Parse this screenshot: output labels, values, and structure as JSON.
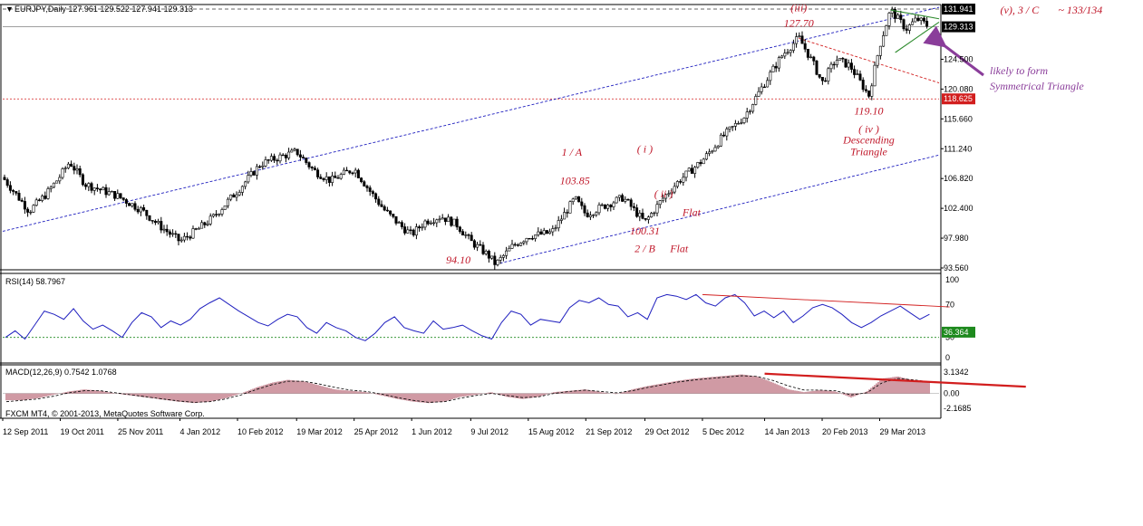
{
  "chart_data": [
    {
      "panel": "price",
      "type": "candlestick",
      "header": "EURJPY,Daily  127.961 129.522 127.941 129.313",
      "y_ticks": [
        "131.941",
        "129.313",
        "124.500",
        "120.080",
        "118.625",
        "115.660",
        "111.240",
        "106.820",
        "102.400",
        "97.980",
        "93.560"
      ],
      "ylim": [
        93.56,
        131.941
      ],
      "price_tags": [
        {
          "label": "131.941",
          "value": 131.941,
          "color": "#000000"
        },
        {
          "label": "129.313",
          "value": 129.313,
          "color": "#000000"
        },
        {
          "label": "118.625",
          "value": 118.625,
          "color": "#d21e1e"
        }
      ],
      "x_labels": [
        "12 Sep 2011",
        "19 Oct 2011",
        "25 Nov 2011",
        "4 Jan 2012",
        "10 Feb 2012",
        "19 Mar 2012",
        "25 Apr 2012",
        "1 Jun 2012",
        "9 Jul 2012",
        "15 Aug 2012",
        "21 Sep 2012",
        "29 Oct 2012",
        "5 Dec 2012",
        "14 Jan 2013",
        "20 Feb 2013",
        "29 Mar 2013"
      ],
      "price_path": [
        [
          "12 Sep 2011",
          107.0
        ],
        [
          "29 Sep 2011",
          102.0
        ],
        [
          "10 Oct 2011",
          104.5
        ],
        [
          "19 Oct 2011",
          107.2
        ],
        [
          "25 Oct 2011",
          109.3
        ],
        [
          "4 Nov 2011",
          106.0
        ],
        [
          "25 Nov 2011",
          104.2
        ],
        [
          "10 Dec 2011",
          102.2
        ],
        [
          "22 Dec 2011",
          99.8
        ],
        [
          "4 Jan 2012",
          97.5
        ],
        [
          "15 Jan 2012",
          99.2
        ],
        [
          "25 Jan 2012",
          101.0
        ],
        [
          "10 Feb 2012",
          105.0
        ],
        [
          "25 Feb 2012",
          109.0
        ],
        [
          "8 Mar 2012",
          110.0
        ],
        [
          "19 Mar 2012",
          110.8
        ],
        [
          "30 Mar 2012",
          108.0
        ],
        [
          "10 Apr 2012",
          106.5
        ],
        [
          "25 Apr 2012",
          108.3
        ],
        [
          "5 May 2012",
          105.0
        ],
        [
          "15 May 2012",
          102.0
        ],
        [
          "25 May 2012",
          99.8
        ],
        [
          "1 Jun 2012",
          98.5
        ],
        [
          "10 Jun 2012",
          100.5
        ],
        [
          "20 Jun 2012",
          101.2
        ],
        [
          "30 Jun 2012",
          100.0
        ],
        [
          "9 Jul 2012",
          97.5
        ],
        [
          "20 Jul 2012",
          95.5
        ],
        [
          "25 Jul 2012",
          94.1
        ],
        [
          "5 Aug 2012",
          96.8
        ],
        [
          "15 Aug 2012",
          98.3
        ],
        [
          "30 Aug 2012",
          98.8
        ],
        [
          "14 Sep 2012",
          103.85
        ],
        [
          "21 Sep 2012",
          101.5
        ],
        [
          "5 Oct 2012",
          103.0
        ],
        [
          "15 Oct 2012",
          104.0
        ],
        [
          "29 Oct 2012",
          100.31
        ],
        [
          "10 Nov 2012",
          104.0
        ],
        [
          "20 Nov 2012",
          106.5
        ],
        [
          "5 Dec 2012",
          109.5
        ],
        [
          "18 Dec 2012",
          113.0
        ],
        [
          "1 Jan 2013",
          116.0
        ],
        [
          "14 Jan 2013",
          121.0
        ],
        [
          "25 Jan 2013",
          125.0
        ],
        [
          "5 Feb 2013",
          127.7
        ],
        [
          "14 Feb 2013",
          124.0
        ],
        [
          "20 Feb 2013",
          121.0
        ],
        [
          "1 Mar 2013",
          124.5
        ],
        [
          "10 Mar 2013",
          123.5
        ],
        [
          "22 Mar 2013",
          119.1
        ],
        [
          "29 Mar 2013",
          126.5
        ],
        [
          "5 Apr 2013",
          131.8
        ],
        [
          "15 Apr 2013",
          129.0
        ],
        [
          "22 Apr 2013",
          130.5
        ],
        [
          "30 Apr 2013",
          129.313
        ]
      ],
      "annotations": [
        {
          "text": "(iii)",
          "date": "5 Feb 2013",
          "value": 131.6
        },
        {
          "text": "127.70",
          "date": "5 Feb 2013",
          "value": 129.3
        },
        {
          "text": "(v), 3 / C",
          "date": "27 Jun 2013",
          "value": 131.3
        },
        {
          "text": "~ 133/134",
          "date": "5 Aug 2013",
          "value": 131.3
        },
        {
          "text": "119.10",
          "date": "22 Mar 2013",
          "value": 116.3
        },
        {
          "text": "( iv )",
          "date": "22 Mar 2013",
          "value": 113.6
        },
        {
          "text": "Descending",
          "date": "22 Mar 2013",
          "value": 112.0
        },
        {
          "text": "Triangle",
          "date": "22 Mar 2013",
          "value": 110.3
        },
        {
          "text": "1 / A",
          "date": "12 Sep 2012",
          "value": 110.2
        },
        {
          "text": "103.85",
          "date": "14 Sep 2012",
          "value": 106.0
        },
        {
          "text": "( i )",
          "date": "29 Oct 2012",
          "value": 110.7
        },
        {
          "text": "( ii )",
          "date": "10 Nov 2012",
          "value": 104.0
        },
        {
          "text": "Flat",
          "date": "28 Nov 2012",
          "value": 101.3
        },
        {
          "text": "100.31",
          "date": "29 Oct 2012",
          "value": 98.5
        },
        {
          "text": "2 / B",
          "date": "29 Oct 2012",
          "value": 95.9
        },
        {
          "text": "Flat",
          "date": "20 Nov 2012",
          "value": 95.9
        },
        {
          "text": "94.10",
          "date": "1 Jul 2012",
          "value": 94.2
        }
      ],
      "side_note": [
        "likely to form",
        "Symmetrical Triangle"
      ],
      "colors": {
        "trendline": "#1f1fbf",
        "resistance": "#d21e1e",
        "triangle": "#2e8b2e",
        "arrow": "#8a3d9a"
      }
    },
    {
      "panel": "rsi",
      "type": "line",
      "header": "RSI(14) 58.7967",
      "y_ticks": [
        "100",
        "70",
        "30",
        "0"
      ],
      "ylim": [
        0,
        100
      ],
      "value_tag": {
        "label": "36.364",
        "value": 36.364,
        "color": "#1e8a1e"
      },
      "levels": [
        30
      ],
      "values": [
        30,
        38,
        28,
        45,
        62,
        58,
        52,
        65,
        50,
        40,
        45,
        38,
        30,
        48,
        60,
        55,
        42,
        50,
        45,
        52,
        65,
        72,
        78,
        70,
        62,
        55,
        48,
        44,
        52,
        58,
        55,
        42,
        35,
        48,
        42,
        38,
        30,
        26,
        35,
        48,
        55,
        42,
        38,
        35,
        50,
        40,
        42,
        45,
        38,
        32,
        28,
        48,
        62,
        58,
        45,
        52,
        50,
        48,
        66,
        75,
        72,
        78,
        70,
        68,
        55,
        60,
        52,
        78,
        82,
        80,
        76,
        82,
        72,
        68,
        78,
        82,
        72,
        56,
        62,
        54,
        62,
        48,
        56,
        66,
        70,
        66,
        58,
        48,
        42,
        48,
        56,
        62,
        68,
        60,
        52,
        58
      ],
      "resistance_line": [
        [
          "5 Dec 2012",
          82
        ],
        [
          "13 May 2013",
          67
        ]
      ]
    },
    {
      "panel": "macd",
      "type": "bar",
      "header": "MACD(12,26,9) 0.7542 1.0768",
      "y_ticks": [
        "3.1342",
        "0.00",
        "-2.1685"
      ],
      "ylim": [
        -2.1685,
        3.1342
      ],
      "footer": "FXCM MT4, © 2001-2013, MetaQuotes Software Corp.",
      "values": [
        -1.0,
        -1.0,
        -0.7,
        -0.2,
        0.3,
        0.6,
        0.4,
        0.0,
        -0.3,
        -0.6,
        -0.9,
        -1.2,
        -1.4,
        -1.2,
        -0.7,
        0.0,
        0.9,
        1.6,
        2.0,
        1.8,
        1.2,
        0.6,
        0.4,
        0.2,
        -0.3,
        -0.8,
        -1.2,
        -1.4,
        -1.2,
        -0.5,
        -0.2,
        0.2,
        -0.5,
        -0.8,
        -0.5,
        0.2,
        0.4,
        0.6,
        0.2,
        -0.1,
        0.6,
        1.1,
        1.5,
        1.9,
        2.2,
        2.4,
        2.6,
        2.8,
        2.5,
        1.6,
        0.6,
        0.2,
        0.5,
        0.3,
        -0.6,
        0.3,
        2.2,
        2.5,
        1.9,
        1.6
      ],
      "signal_values": [
        -1.2,
        -1.0,
        -0.8,
        -0.4,
        0.1,
        0.4,
        0.4,
        0.1,
        -0.2,
        -0.5,
        -0.8,
        -1.1,
        -1.3,
        -1.2,
        -0.8,
        -0.2,
        0.6,
        1.3,
        1.8,
        1.8,
        1.4,
        0.9,
        0.5,
        0.3,
        -0.1,
        -0.6,
        -1.0,
        -1.3,
        -1.2,
        -0.7,
        -0.3,
        0.0,
        -0.3,
        -0.6,
        -0.5,
        0.0,
        0.3,
        0.5,
        0.3,
        0.1,
        0.4,
        0.9,
        1.3,
        1.7,
        2.0,
        2.2,
        2.4,
        2.6,
        2.5,
        1.9,
        1.1,
        0.5,
        0.5,
        0.4,
        -0.2,
        0.1,
        1.6,
        2.2,
        2.0,
        1.7
      ],
      "resistance_line": [
        [
          "14 Jan 2013",
          2.9
        ],
        [
          "1 Jul 2013",
          1.0
        ]
      ]
    }
  ]
}
